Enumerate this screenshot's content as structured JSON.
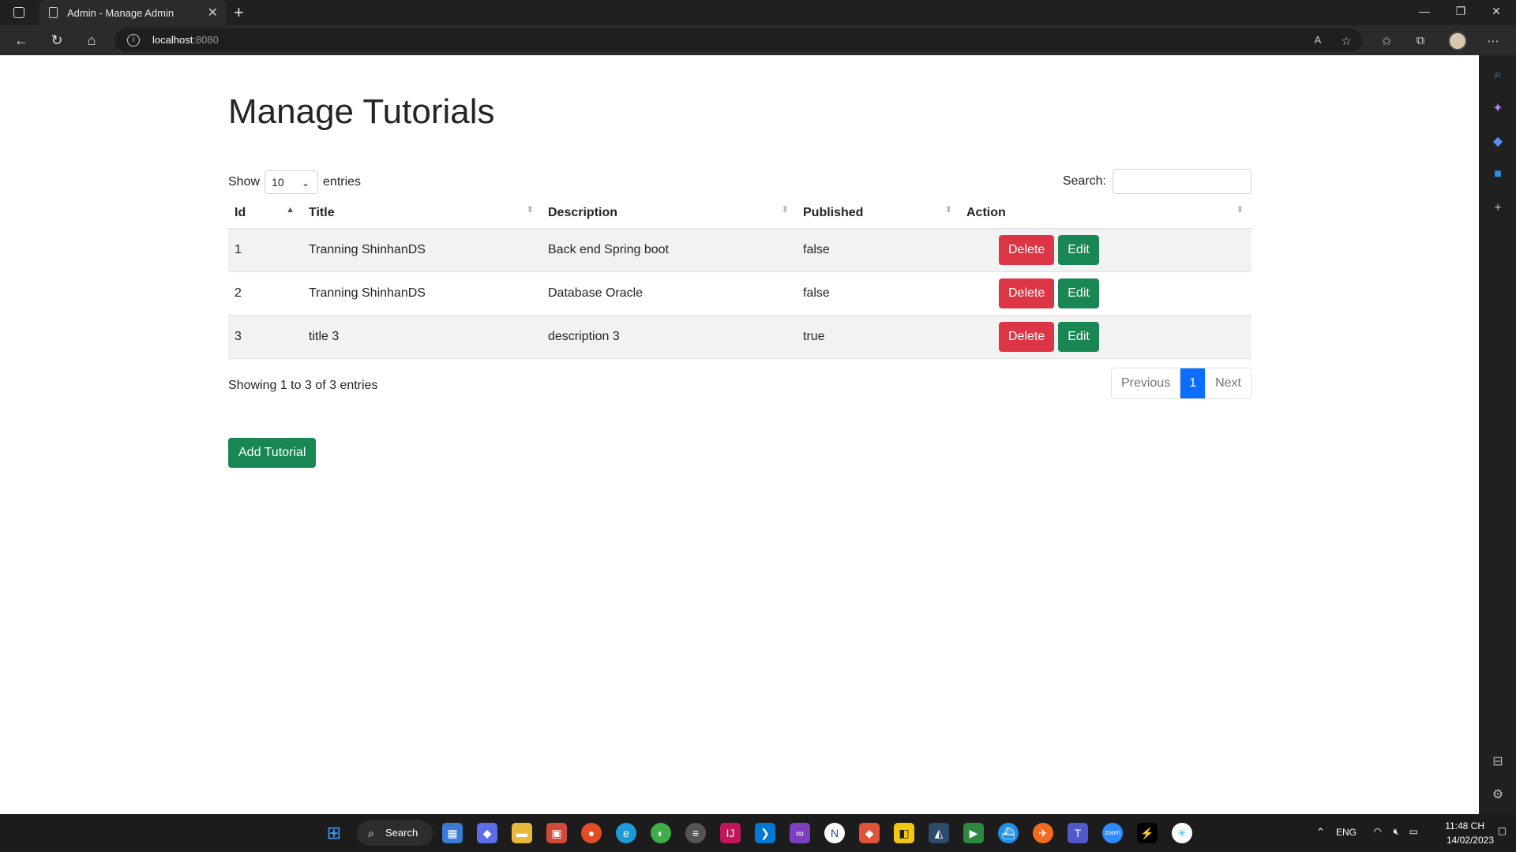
{
  "browser": {
    "tab_title": "Admin - Manage Admin",
    "url_host": "localhost",
    "url_port": ":8080"
  },
  "page": {
    "heading": "Manage Tutorials",
    "show_label": "Show",
    "entries_label": "entries",
    "length_value": "10",
    "search_label": "Search:",
    "search_value": "",
    "columns": [
      "Id",
      "Title",
      "Description",
      "Published",
      "Action"
    ],
    "rows": [
      {
        "id": "1",
        "title": "Tranning ShinhanDS",
        "description": "Back end Spring boot",
        "published": "false"
      },
      {
        "id": "2",
        "title": "Tranning ShinhanDS",
        "description": "Database Oracle",
        "published": "false"
      },
      {
        "id": "3",
        "title": "title 3",
        "description": "description 3",
        "published": "true"
      }
    ],
    "delete_label": "Delete",
    "edit_label": "Edit",
    "info_text": "Showing 1 to 3 of 3 entries",
    "pager": {
      "previous": "Previous",
      "current": "1",
      "next": "Next"
    },
    "add_button": "Add Tutorial"
  },
  "taskbar": {
    "search_label": "Search",
    "language": "ENG",
    "time": "11:48 CH",
    "date": "14/02/2023"
  },
  "colors": {
    "danger": "#dc3545",
    "success": "#198754",
    "primary": "#0d6efd"
  }
}
